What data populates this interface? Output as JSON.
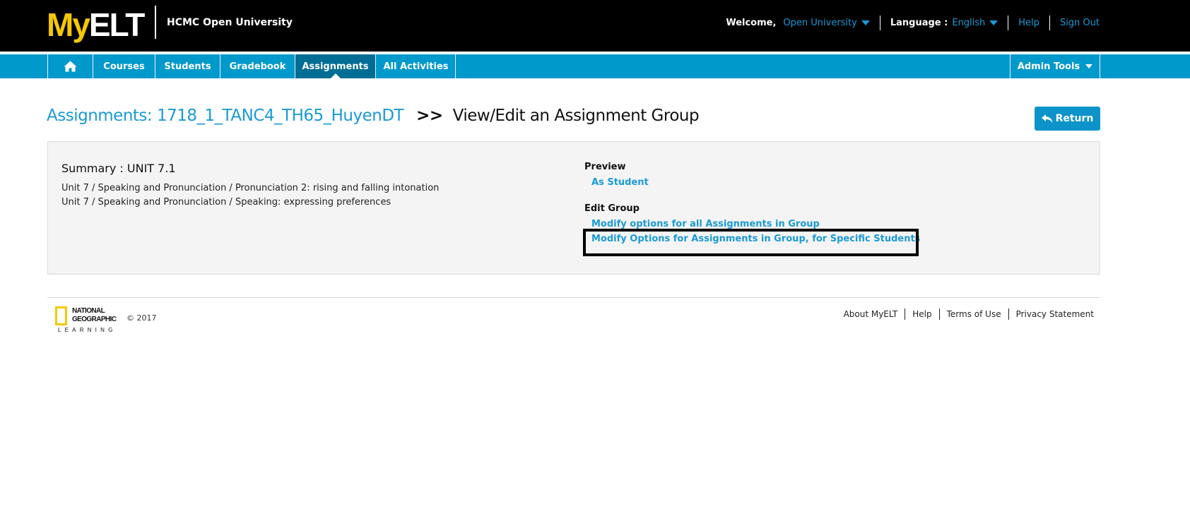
{
  "header": {
    "logo_my": "My",
    "logo_elt": "ELT",
    "institution": "HCMC Open University",
    "welcome_label": "Welcome,",
    "user_name": "Open University",
    "language_label": "Language :",
    "language_value": "English",
    "help": "Help",
    "sign_out": "Sign Out"
  },
  "nav": {
    "home_icon": "home-icon",
    "items": [
      {
        "label": "Courses"
      },
      {
        "label": "Students"
      },
      {
        "label": "Gradebook"
      },
      {
        "label": "Assignments",
        "active": true
      },
      {
        "label": "All Activities"
      }
    ],
    "admin_tools": "Admin Tools"
  },
  "page": {
    "breadcrumb_link": "Assignments: 1718_1_TANC4_TH65_HuyenDT",
    "separator": ">>",
    "title": "View/Edit an Assignment Group",
    "return_button": "Return",
    "return_icon": "reply-arrow-icon"
  },
  "summary": {
    "title": "Summary : UNIT 7.1",
    "lines": [
      "Unit 7 / Speaking and Pronunciation / Pronunciation 2: rising and falling intonation",
      "Unit 7 / Speaking and Pronunciation / Speaking: expressing preferences"
    ]
  },
  "actions": {
    "preview_label": "Preview",
    "as_student": "As Student",
    "edit_group_label": "Edit Group",
    "modify_all": "Modify options for all Assignments in Group",
    "modify_specific": "Modify Options for Assignments in Group, for Specific Students"
  },
  "footer": {
    "logo_line1": "NATIONAL",
    "logo_line2": "GEOGRAPHIC",
    "logo_line3": "LEARNING",
    "copyright": "© 2017",
    "links": [
      "About MyELT",
      "Help",
      "Terms of Use",
      "Privacy Statement"
    ]
  },
  "colors": {
    "accent": "#1a9ad6",
    "nav_bar": "#0099cc",
    "nav_active": "#006e94",
    "logo_yellow": "#f5c800"
  }
}
